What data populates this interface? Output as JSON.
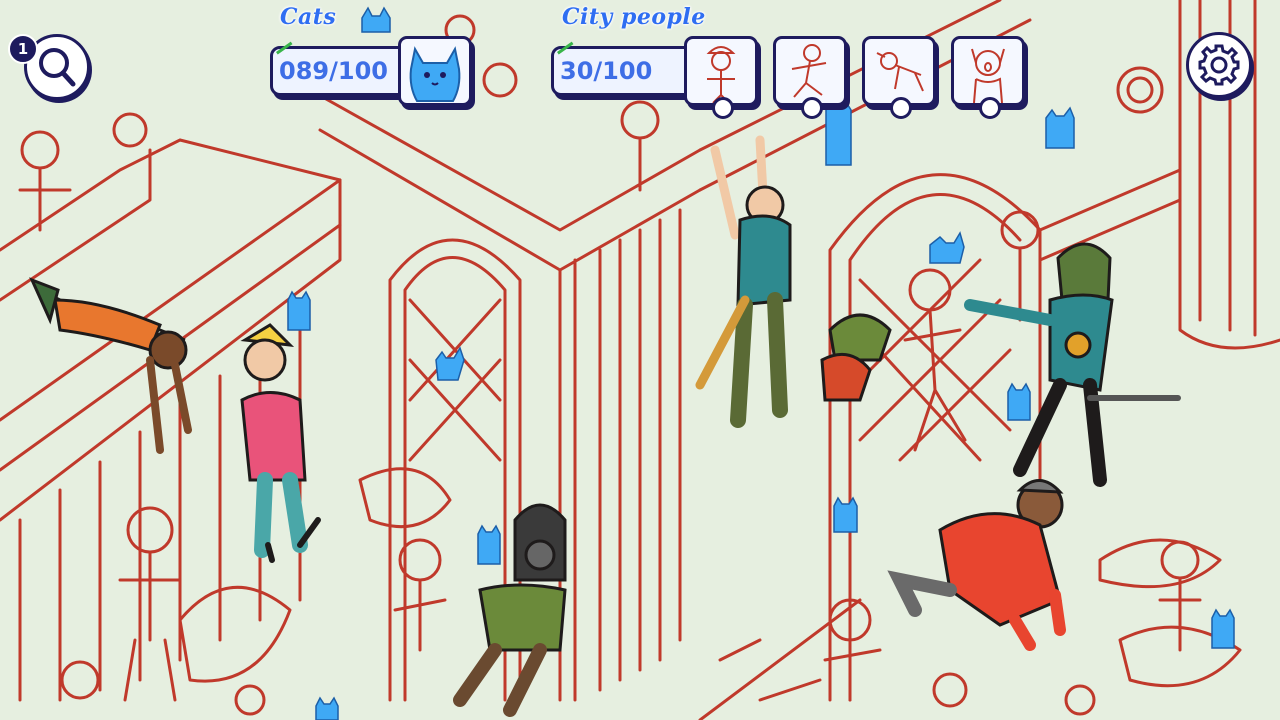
{
  "hud": {
    "cats": {
      "label": "Cats",
      "counter": "089/100",
      "found": 89,
      "total": 100
    },
    "city_people": {
      "label": "City people",
      "counter": "30/100",
      "found": 30,
      "total": 100,
      "targets": [
        {
          "name": "person-with-hat-target"
        },
        {
          "name": "running-person-target"
        },
        {
          "name": "crawling-person-target"
        },
        {
          "name": "screaming-person-target"
        }
      ]
    },
    "hints": {
      "count": "1",
      "icon": "magnifier-icon"
    },
    "settings": {
      "icon": "gear-icon"
    }
  },
  "colors": {
    "background": "#e6efe0",
    "line_art": "#c0392b",
    "cat_blue": "#3fa9f5",
    "hud_navy": "#1e1b5e",
    "hud_text_blue": "#3e6ee6",
    "label_blue": "#2f6ef2"
  }
}
